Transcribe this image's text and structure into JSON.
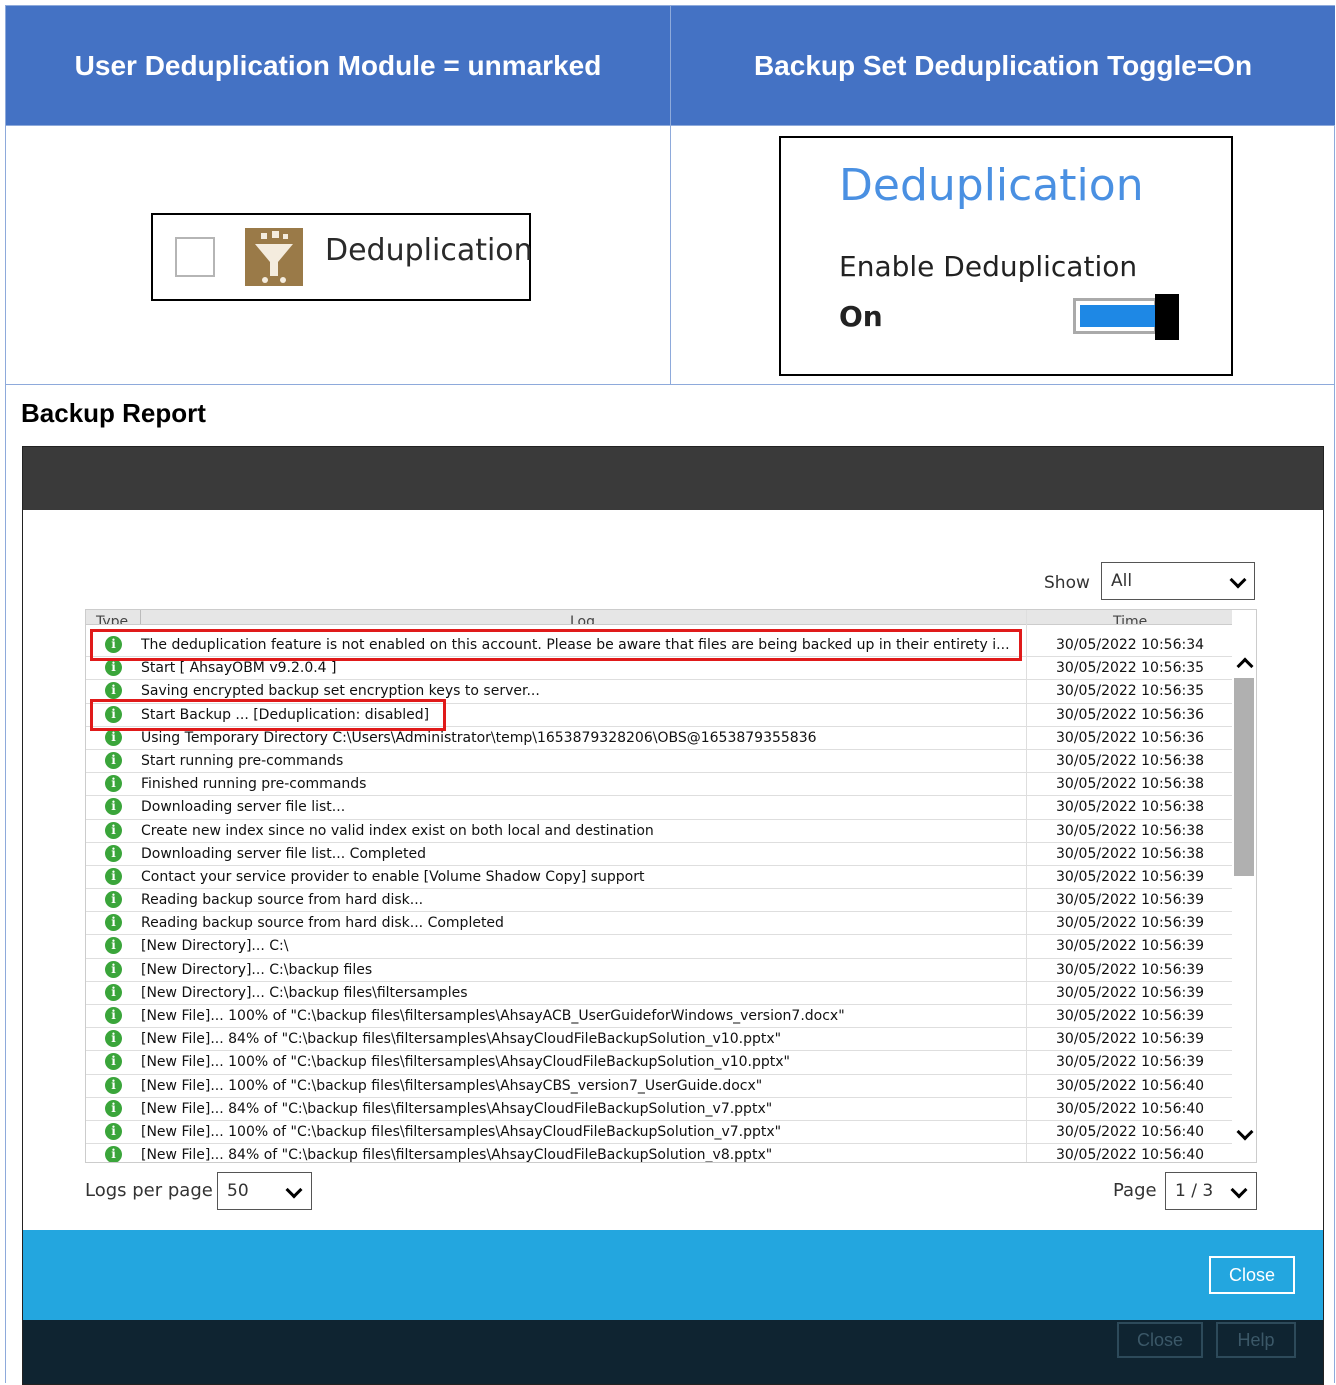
{
  "comparison": {
    "left_header": "User Deduplication Module = unmarked",
    "right_header": "Backup Set Deduplication Toggle=On",
    "module": {
      "label": "Deduplication",
      "checked": false,
      "icon": "funnel-icon"
    },
    "toggle_panel": {
      "title": "Deduplication",
      "subtitle": "Enable Deduplication",
      "state_label": "On",
      "enabled": true
    }
  },
  "report": {
    "title": "Backup Report",
    "show_label": "Show",
    "show_value": "All",
    "columns": {
      "type": "Type",
      "log": "Log",
      "time": "Time"
    },
    "rows": [
      {
        "msg": "The deduplication feature is not enabled on this account. Please be aware that files are being backed up in their entirety i...",
        "time": "30/05/2022 10:56:34"
      },
      {
        "msg": "Start [ AhsayOBM v9.2.0.4 ]",
        "time": "30/05/2022 10:56:35"
      },
      {
        "msg": "Saving encrypted backup set encryption keys to server...",
        "time": "30/05/2022 10:56:35"
      },
      {
        "msg": "Start Backup ... [Deduplication: disabled]",
        "time": "30/05/2022 10:56:36"
      },
      {
        "msg": "Using Temporary Directory C:\\Users\\Administrator\\temp\\1653879328206\\OBS@1653879355836",
        "time": "30/05/2022 10:56:36"
      },
      {
        "msg": "Start running pre-commands",
        "time": "30/05/2022 10:56:38"
      },
      {
        "msg": "Finished running pre-commands",
        "time": "30/05/2022 10:56:38"
      },
      {
        "msg": "Downloading server file list...",
        "time": "30/05/2022 10:56:38"
      },
      {
        "msg": "Create new index since no valid index exist on both local and destination",
        "time": "30/05/2022 10:56:38"
      },
      {
        "msg": "Downloading server file list... Completed",
        "time": "30/05/2022 10:56:38"
      },
      {
        "msg": "Contact your service provider to enable [Volume Shadow Copy] support",
        "time": "30/05/2022 10:56:39"
      },
      {
        "msg": "Reading backup source from hard disk...",
        "time": "30/05/2022 10:56:39"
      },
      {
        "msg": "Reading backup source from hard disk... Completed",
        "time": "30/05/2022 10:56:39"
      },
      {
        "msg": "[New Directory]... C:\\",
        "time": "30/05/2022 10:56:39"
      },
      {
        "msg": "[New Directory]... C:\\backup files",
        "time": "30/05/2022 10:56:39"
      },
      {
        "msg": "[New Directory]... C:\\backup files\\filtersamples",
        "time": "30/05/2022 10:56:39"
      },
      {
        "msg": "[New File]... 100% of \"C:\\backup files\\filtersamples\\AhsayACB_UserGuideforWindows_version7.docx\"",
        "time": "30/05/2022 10:56:39"
      },
      {
        "msg": "[New File]... 84% of \"C:\\backup files\\filtersamples\\AhsayCloudFileBackupSolution_v10.pptx\"",
        "time": "30/05/2022 10:56:39"
      },
      {
        "msg": "[New File]... 100% of \"C:\\backup files\\filtersamples\\AhsayCloudFileBackupSolution_v10.pptx\"",
        "time": "30/05/2022 10:56:39"
      },
      {
        "msg": "[New File]... 100% of \"C:\\backup files\\filtersamples\\AhsayCBS_version7_UserGuide.docx\"",
        "time": "30/05/2022 10:56:40"
      },
      {
        "msg": "[New File]... 84% of \"C:\\backup files\\filtersamples\\AhsayCloudFileBackupSolution_v7.pptx\"",
        "time": "30/05/2022 10:56:40"
      },
      {
        "msg": "[New File]... 100% of \"C:\\backup files\\filtersamples\\AhsayCloudFileBackupSolution_v7.pptx\"",
        "time": "30/05/2022 10:56:40"
      },
      {
        "msg": "[New File]... 84% of \"C:\\backup files\\filtersamples\\AhsayCloudFileBackupSolution_v8.pptx\"",
        "time": "30/05/2022 10:56:40"
      }
    ],
    "row_icon": "info-icon",
    "logs_per_page_label": "Logs per page",
    "logs_per_page_value": "50",
    "page_label": "Page",
    "page_value": "1 / 3",
    "close_label": "Close",
    "footer_close_label": "Close",
    "footer_help_label": "Help"
  },
  "colors": {
    "header_blue": "#4472c4",
    "highlight_red": "#e01a1a",
    "info_green": "#3aa53a",
    "action_bar_blue": "#23a6df",
    "toggle_blue": "#1e88e5"
  }
}
